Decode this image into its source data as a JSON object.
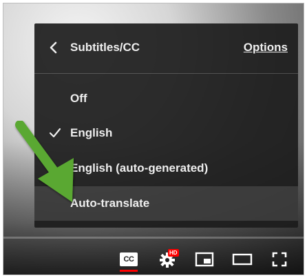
{
  "menu": {
    "title": "Subtitles/CC",
    "options_label": "Options",
    "items": [
      {
        "label": "Off",
        "checked": false
      },
      {
        "label": "English",
        "checked": true
      },
      {
        "label": "English (auto-generated)",
        "checked": false
      },
      {
        "label": "Auto-translate",
        "checked": false,
        "highlighted": true
      }
    ]
  },
  "controls": {
    "cc_label": "CC",
    "hd_badge": "HD",
    "cc_active_color": "#ff0000"
  },
  "annotation": {
    "arrow_color": "#5aa832"
  },
  "icons": [
    "chevron-left-icon",
    "checkmark-icon",
    "cc-icon",
    "settings-gear-icon",
    "miniplayer-icon",
    "theater-mode-icon",
    "fullscreen-icon",
    "green-arrow-icon"
  ]
}
